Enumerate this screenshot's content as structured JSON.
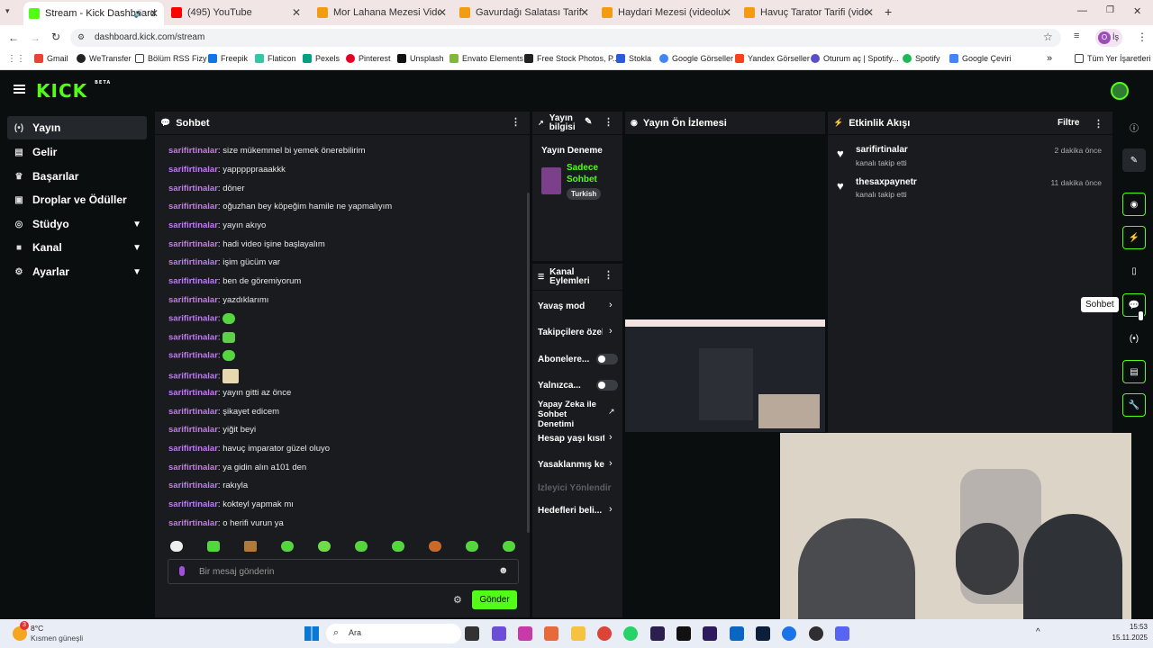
{
  "browser": {
    "tabs": [
      {
        "title": "Stream - Kick Dashboard",
        "color": "#53fc18",
        "active": true
      },
      {
        "title": "(495) YouTube",
        "color": "#ff0000"
      },
      {
        "title": "Mor Lahana Mezesi Videolu An",
        "color": "#f39c12"
      },
      {
        "title": "Gavurdağı Salatası Tarifi - Nefis",
        "color": "#f39c12"
      },
      {
        "title": "Haydari Mezesi (videolu) - Nefis",
        "color": "#f39c12"
      },
      {
        "title": "Havuç Tarator Tarifi (videolu) - N",
        "color": "#f39c12"
      }
    ],
    "new_tab": "+",
    "url": "dashboard.kick.com/stream",
    "profile_letter": "O",
    "profile_label": "İş",
    "bookmarks": [
      "Gmail",
      "WeTransfer",
      "Bölüm RSS Fizy",
      "Freepik",
      "Flaticon",
      "Pexels",
      "Pinterest",
      "Unsplash",
      "Envato Elements",
      "Free Stock Photos, P...",
      "Stokla",
      "Google Görseller",
      "Yandex Görseller",
      "Oturum aç | Spotify...",
      "Spotify",
      "Google Çeviri"
    ],
    "bookmarks_more": "»",
    "all_bookmarks": "Tüm Yer İşaretleri"
  },
  "kick": {
    "logo": "KICK",
    "logo_badge": "BETA",
    "accent": "#53fc18",
    "nav": [
      {
        "label": "Yayın",
        "icon": "(•)",
        "active": true
      },
      {
        "label": "Gelir",
        "icon": "▤"
      },
      {
        "label": "Başarılar",
        "icon": "♛"
      },
      {
        "label": "Droplar ve Ödüller",
        "icon": "▣"
      },
      {
        "label": "Stüdyo",
        "icon": "◎",
        "chevron": true
      },
      {
        "label": "Kanal",
        "icon": "■",
        "chevron": true
      },
      {
        "label": "Ayarlar",
        "icon": "⚙",
        "chevron": true
      }
    ]
  },
  "chat": {
    "title": "Sohbet",
    "messages": [
      {
        "user": "sarifirtinalar",
        "text": "size mükemmel bi yemek önerebilirim"
      },
      {
        "user": "sarifirtinalar",
        "text": "yapppppraaakkk"
      },
      {
        "user": "sarifirtinalar",
        "text": "döner"
      },
      {
        "user": "sarifirtinalar",
        "text": "oğuzhan bey köpeğim hamile ne yapmalıyım"
      },
      {
        "user": "sarifirtinalar",
        "text": "yayın akıyo"
      },
      {
        "user": "sarifirtinalar",
        "text": "hadi video işine başlayalım"
      },
      {
        "user": "sarifirtinalar",
        "text": "işim gücüm var"
      },
      {
        "user": "sarifirtinalar",
        "text": "ben de göremiyorum"
      },
      {
        "user": "sarifirtinalar",
        "text": "yazdıklarımı"
      },
      {
        "user": "sarifirtinalar",
        "text": "",
        "emote": true
      },
      {
        "user": "sarifirtinalar",
        "text": "",
        "emote": true
      },
      {
        "user": "sarifirtinalar",
        "text": "",
        "emote": true
      },
      {
        "user": "sarifirtinalar",
        "text": "",
        "emote": true
      },
      {
        "user": "sarifirtinalar",
        "text": "yayın gitti az önce"
      },
      {
        "user": "sarifirtinalar",
        "text": "şikayet edicem"
      },
      {
        "user": "sarifirtinalar",
        "text": "yiğit beyi"
      },
      {
        "user": "sarifirtinalar",
        "text": "havuç imparator güzel oluyo"
      },
      {
        "user": "sarifirtinalar",
        "text": "ya gidin alın a101 den"
      },
      {
        "user": "sarifirtinalar",
        "text": "rakıyla"
      },
      {
        "user": "sarifirtinalar",
        "text": "kokteyl yapmak mı"
      },
      {
        "user": "sarifirtinalar",
        "text": "o herifi vurun ya"
      }
    ],
    "placeholder": "Bir mesaj gönderin",
    "send": "Gönder"
  },
  "stream_info": {
    "title": "Yayın bilgisi",
    "stream_title": "Yayın Deneme",
    "category": "Sadece Sohbet",
    "tag": "Turkish"
  },
  "channel_actions": {
    "title": "Kanal Eylemleri",
    "items": [
      {
        "label": "Yavaş mod",
        "type": "chevron"
      },
      {
        "label": "Takipçilere özel",
        "type": "chevron"
      },
      {
        "label": "Abonelere...",
        "type": "toggle"
      },
      {
        "label": "Yalnızca...",
        "type": "toggle"
      },
      {
        "label": "Yapay Zeka ile Sohbet Denetimi",
        "type": "external"
      },
      {
        "label": "Hesap yaşı kısıtl",
        "type": "chevron"
      },
      {
        "label": "Yasaklanmış kel",
        "type": "chevron"
      },
      {
        "label": "İzleyici Yönlendir",
        "type": "disabled"
      },
      {
        "label": "Hedefleri beli...",
        "type": "chevron"
      }
    ]
  },
  "preview": {
    "title": "Yayın Ön İzlemesi"
  },
  "activity": {
    "title": "Etkinlik Akışı",
    "filter": "Filtre",
    "events": [
      {
        "user": "sarifirtinalar",
        "action": "kanalı takip etti",
        "time": "2 dakika önce"
      },
      {
        "user": "thesaxpaynetr",
        "action": "kanalı takip etti",
        "time": "11 dakika önce"
      }
    ]
  },
  "tooltip": "Sohbet",
  "taskbar": {
    "temp": "8°C",
    "weather": "Kısmen güneşli",
    "search": "Ara",
    "time": "15:53",
    "date": "15.11.2025",
    "badge": "3"
  }
}
